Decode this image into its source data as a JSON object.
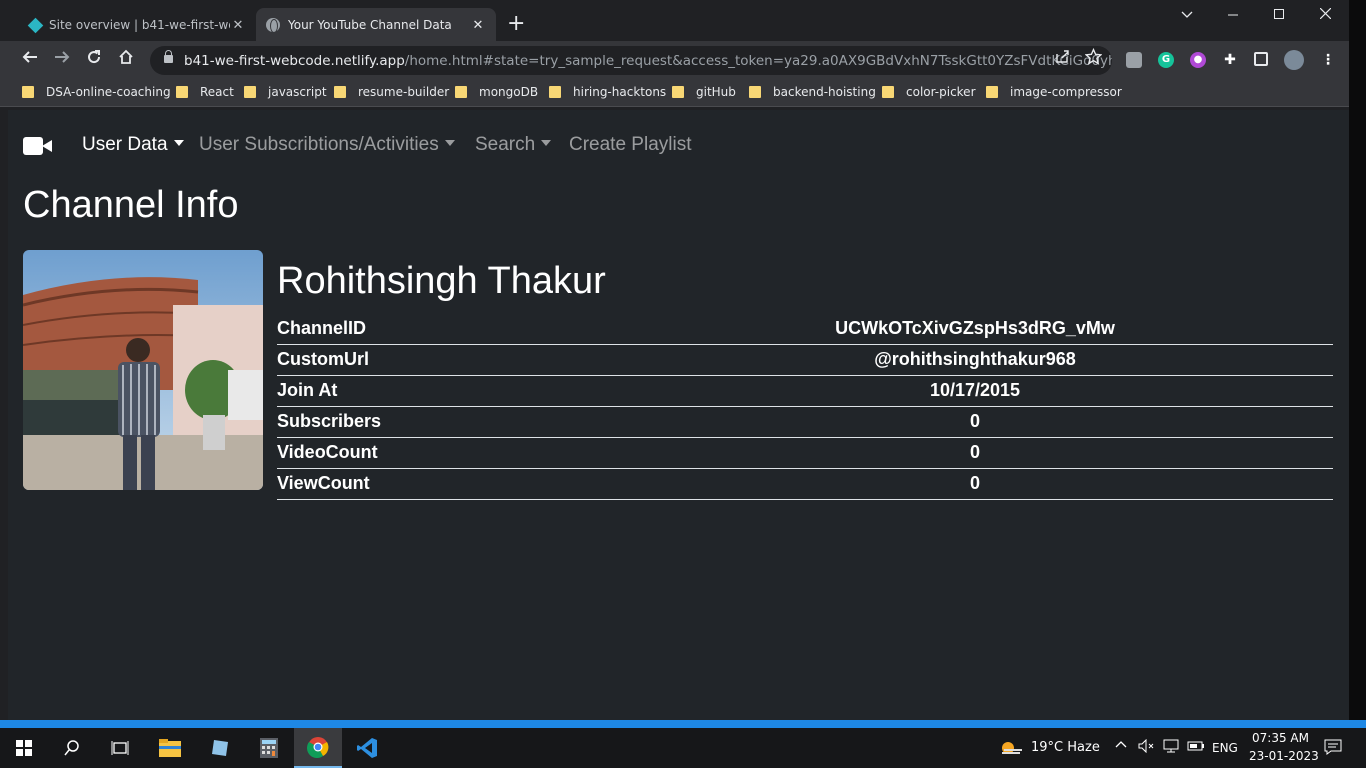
{
  "browser": {
    "tabs": [
      {
        "title": "Site overview | b41-we-first-webc",
        "close": "✕"
      },
      {
        "title": "Your YouTube Channel Data",
        "close": "✕"
      }
    ],
    "new_tab": "+",
    "url_host": "b41-we-first-webcode.netlify.app",
    "url_path": "/home.html#state=try_sample_request&access_token=ya29.a0AX9GBdVxhN7TsskGtt0YZsFVdtKCiGo0yh...",
    "bookmarks": [
      "DSA-online-coaching",
      "React",
      "javascript",
      "resume-builder",
      "mongoDB",
      "hiring-hacktons",
      "gitHub",
      "backend-hoisting",
      "color-picker",
      "image-compressor"
    ]
  },
  "navbar": {
    "items": [
      {
        "label": "User Data"
      },
      {
        "label": "User Subscribtions/Activities"
      },
      {
        "label": "Search"
      },
      {
        "label": "Create Playlist"
      }
    ]
  },
  "page": {
    "title": "Channel Info",
    "channel_name": "Rohithsingh Thakur",
    "rows": [
      {
        "key": "ChannelID",
        "value": "UCWkOTcXivGZspHs3dRG_vMw"
      },
      {
        "key": "CustomUrl",
        "value": "@rohithsinghthakur968"
      },
      {
        "key": "Join At",
        "value": "10/17/2015"
      },
      {
        "key": "Subscribers",
        "value": "0"
      },
      {
        "key": "VideoCount",
        "value": "0"
      },
      {
        "key": "ViewCount",
        "value": "0"
      }
    ]
  },
  "taskbar": {
    "weather": "19°C  Haze",
    "language": "ENG",
    "time": "07:35 AM",
    "date": "23-01-2023"
  },
  "colors": {
    "page_bg": "#212529",
    "chrome_bg": "#202124",
    "toolbar_bg": "#35363a",
    "accent_blue": "#1e88e5"
  }
}
